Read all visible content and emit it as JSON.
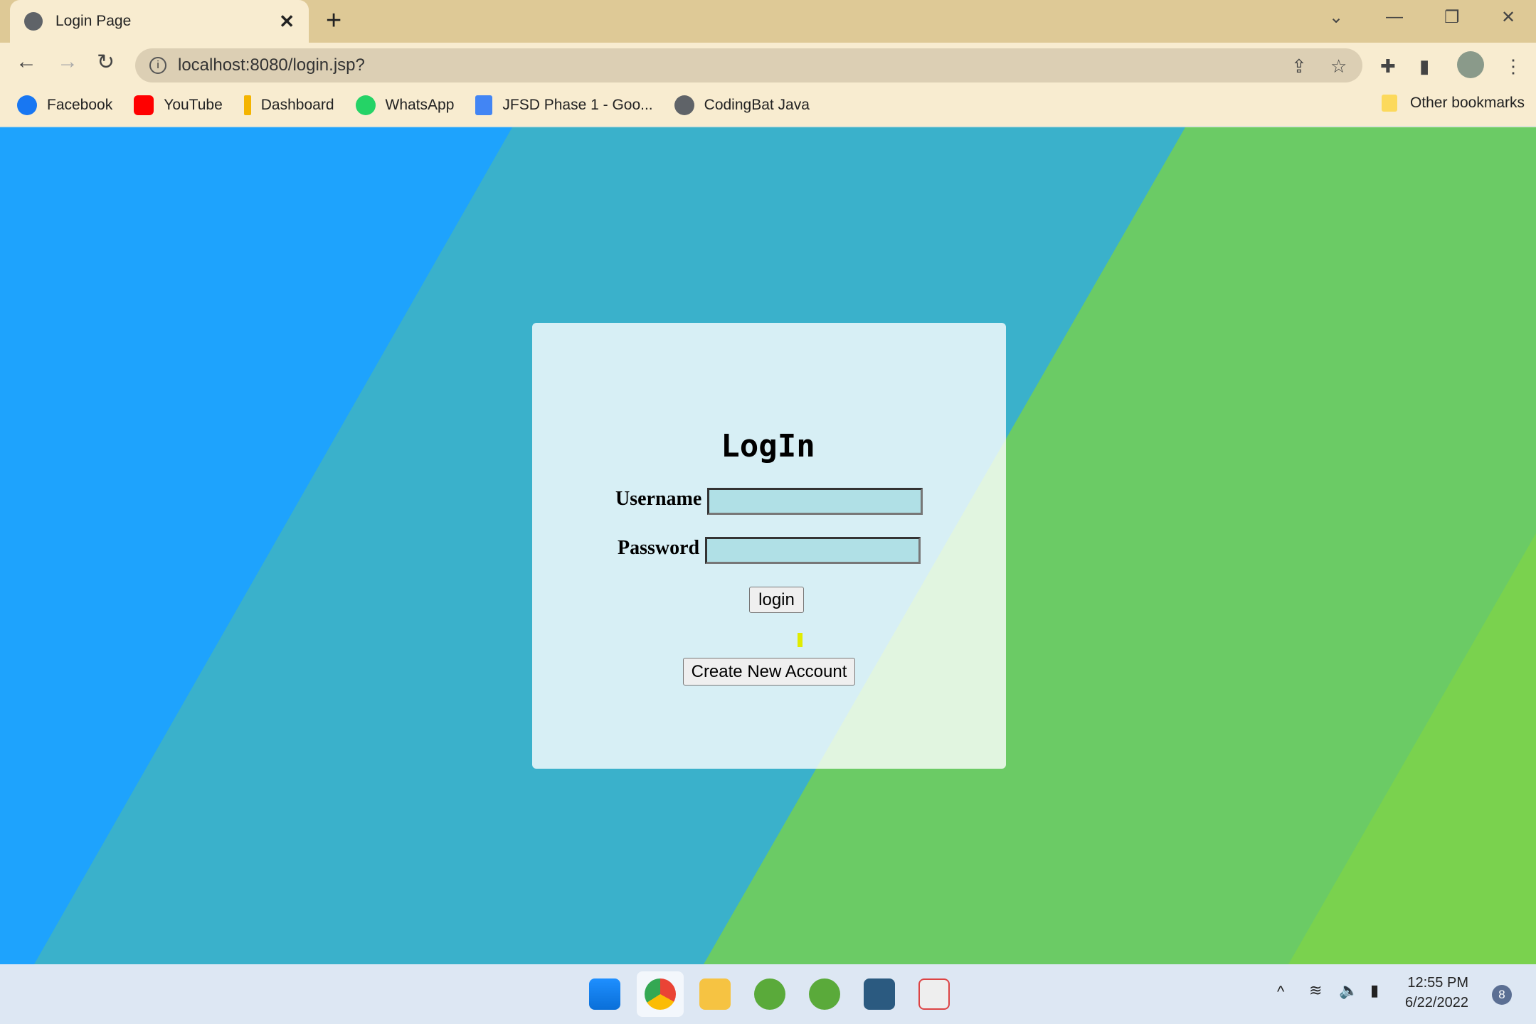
{
  "browser": {
    "tab_title": "Login Page",
    "url": "localhost:8080/login.jsp?",
    "bookmarks": [
      {
        "label": "Facebook",
        "color": "#1877f2"
      },
      {
        "label": "YouTube",
        "color": "#ff0000"
      },
      {
        "label": "Dashboard",
        "color": "#f4b400"
      },
      {
        "label": "WhatsApp",
        "color": "#25d366"
      },
      {
        "label": "JFSD Phase 1 - Goo...",
        "color": "#4285f4"
      },
      {
        "label": "CodingBat Java",
        "color": "#5f6368"
      }
    ],
    "other_bookmarks": "Other bookmarks"
  },
  "form": {
    "title": "LogIn",
    "username_label": "Username",
    "password_label": "Password",
    "username_value": "",
    "password_value": "",
    "login_label": "login",
    "create_label": "Create New Account"
  },
  "taskbar": {
    "time": "12:55 PM",
    "date": "6/22/2022",
    "notifications": "8"
  },
  "colors": {
    "bg_blue": "#1ea3fd",
    "bg_teal": "#3ab1cb",
    "bg_green": "#6bcb65",
    "bg_green2": "#7ad24e",
    "input_bg": "#b0e0e6"
  }
}
